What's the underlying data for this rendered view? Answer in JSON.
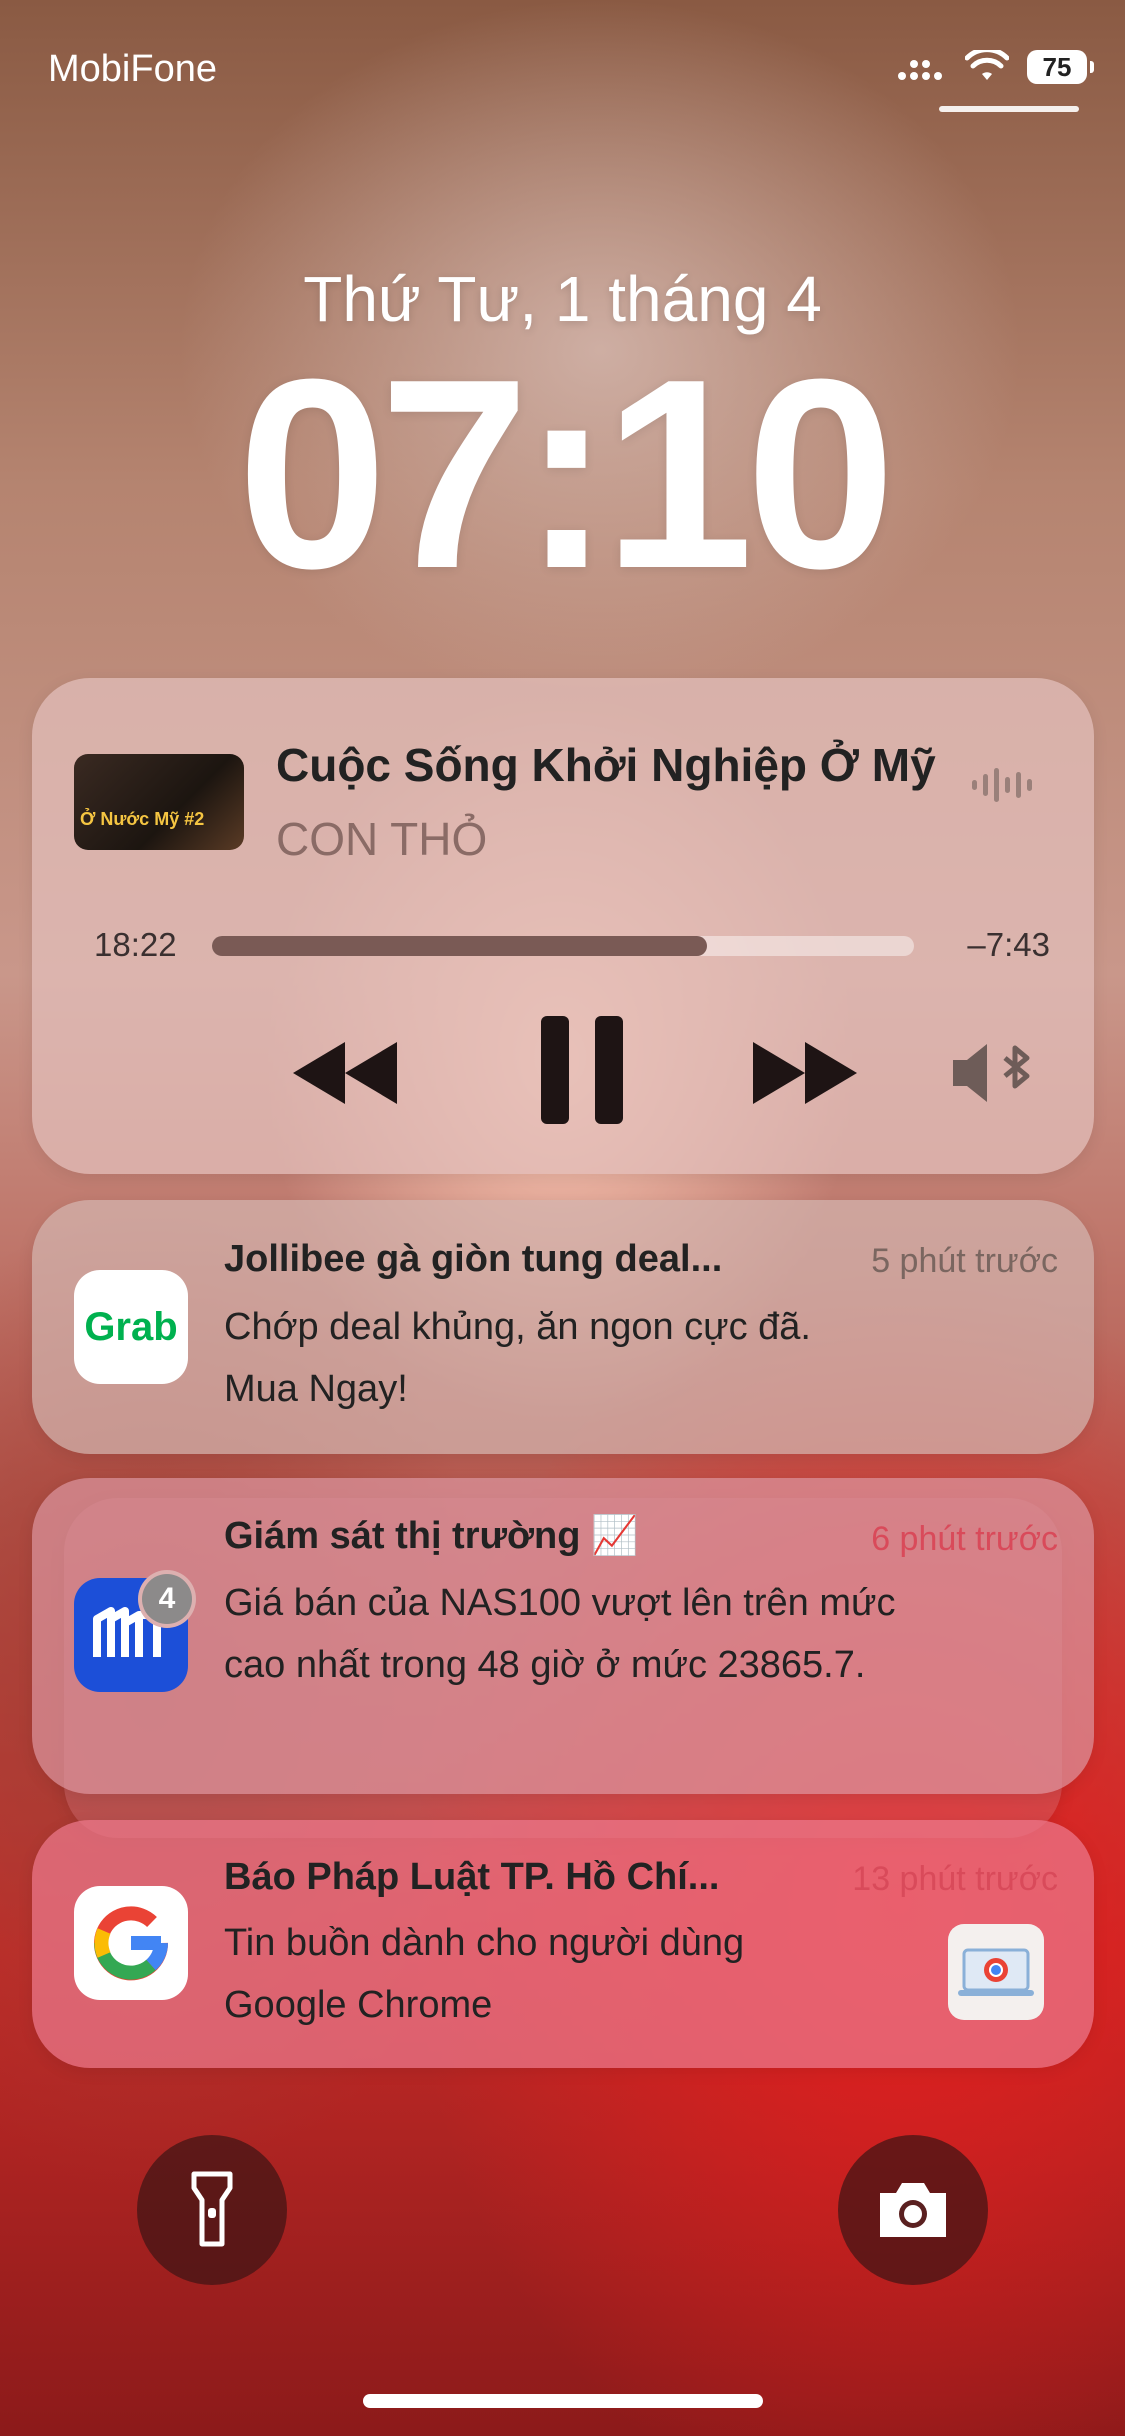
{
  "status_bar": {
    "carrier": "MobiFone",
    "battery": "75"
  },
  "lock_screen": {
    "date": "Thứ Tư, 1 tháng 4",
    "time": "07:10"
  },
  "media": {
    "title": "Cuộc Sống Khởi Nghiệp Ở Mỹ",
    "artist": "CON THỎ",
    "artwork_text": "Ở Nước Mỹ #2",
    "elapsed": "18:22",
    "remaining": "–7:43",
    "progress": 0.705,
    "icons": [
      "rewind-icon",
      "pause-icon",
      "fast-forward-icon",
      "speaker-bluetooth-icon",
      "waveform-icon"
    ]
  },
  "notifications": [
    {
      "app": "Grab",
      "title": "Jollibee gà giòn tung deal...",
      "time": "5 phút trước",
      "body": [
        "Chớp deal khủng, ăn ngon cực đã.",
        "Mua Ngay!"
      ]
    },
    {
      "app": "MT",
      "badge": "4",
      "title": "Giám sát thị trường 📈",
      "time": "6 phút trước",
      "body": [
        "Giá bán của NAS100 vượt lên trên mức",
        "cao nhất trong 48 giờ ở mức 23865.7."
      ]
    },
    {
      "app": "Google",
      "title": "Báo Pháp Luật TP. Hồ Chí...",
      "time": "13 phút trước",
      "body": [
        "Tin buồn dành cho người dùng",
        "Google Chrome"
      ]
    }
  ],
  "colors": {
    "grab_green": "#00b14f",
    "mt_blue": "#1c4fd8",
    "time_red": "#d94a5a"
  },
  "bottom": {
    "left_icon": "flashlight-icon",
    "right_icon": "camera-icon"
  }
}
